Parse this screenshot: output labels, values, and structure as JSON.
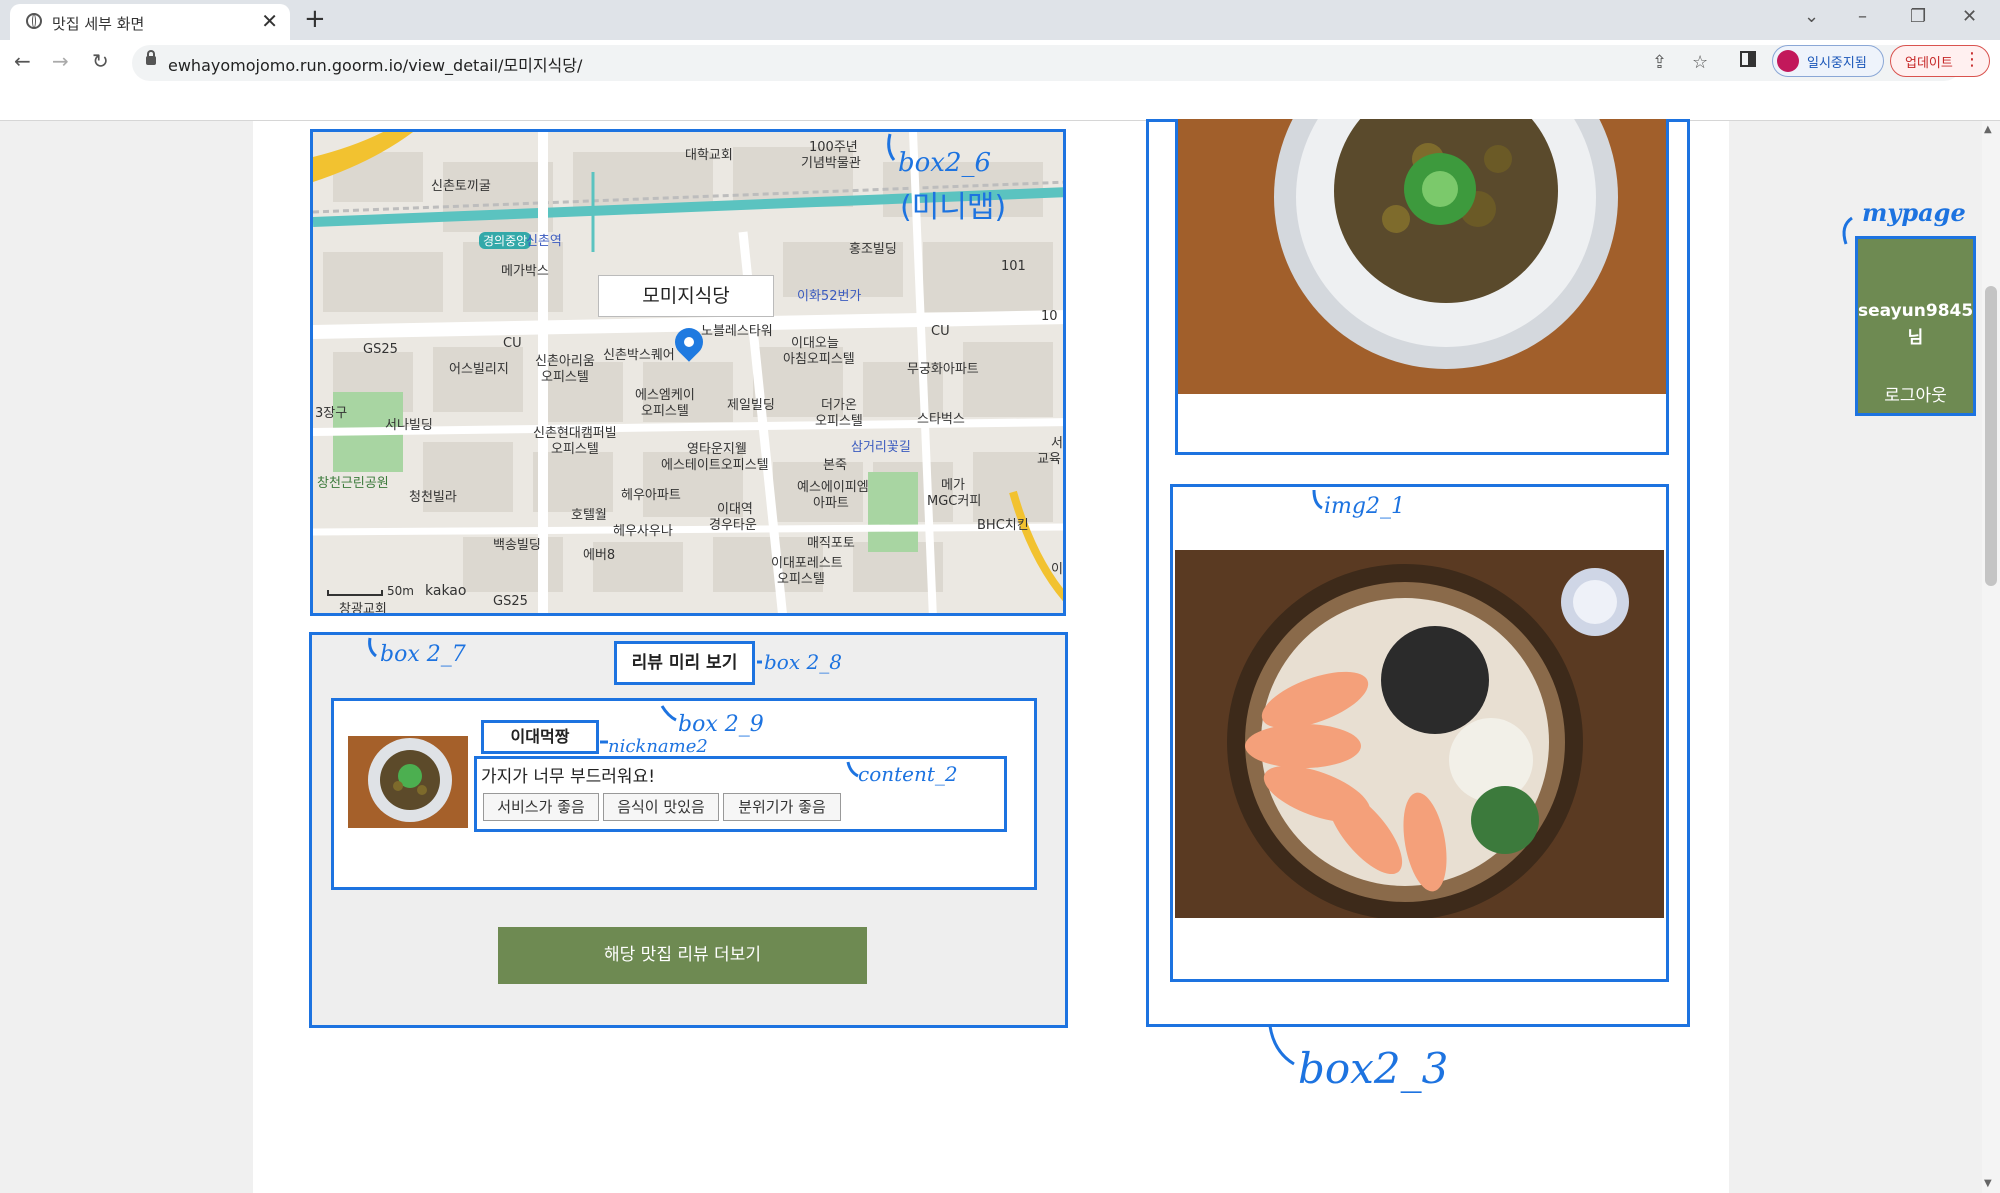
{
  "browser": {
    "tab_title": "맛집 세부 화면",
    "url": "ewhayomojomo.run.goorm.io/view_detail/모미지식당/",
    "profile_label": "일시중지됨",
    "update_label": "업데이트"
  },
  "map": {
    "restaurant_name": "모미지식당",
    "scale": "50m",
    "provider": "kakao",
    "labels": [
      "대학교회",
      "100주년",
      "기념박물관",
      "신촌토끼굴",
      "경의중앙",
      "신촌역",
      "홍조빌딩",
      "메가박스",
      "이화52번가",
      "101",
      "10",
      "노블레스타워",
      "신촌박스퀘어",
      "GS25",
      "CU",
      "어스빌리지",
      "신촌아리움",
      "오피스텔",
      "이대오늘",
      "아침오피스텔",
      "CU",
      "무궁화아파트",
      "에스엠케이",
      "오피스텔",
      "제일빌딩",
      "더가온",
      "오피스텔",
      "스타벅스",
      "3장구",
      "서나빌딩",
      "신촌현대캠퍼빌",
      "오피스텔",
      "영타운지웰",
      "에스테이트오피스텔",
      "본죽",
      "삼거리꽃길",
      "창천근린공원",
      "청천빌라",
      "호텔월",
      "헤우아파트",
      "이대역",
      "경우타운",
      "예스에이피엠",
      "아파트",
      "메가",
      "MGC커피",
      "BHC치킨",
      "헤우사우나",
      "백송빌딩",
      "매직포토",
      "에버8",
      "이대포레스트",
      "오피스텔",
      "창광교회",
      "GS25",
      "서",
      "교육",
      "이"
    ]
  },
  "review_preview": {
    "title": "리뷰 미리 보기",
    "nickname": "이대먹짱",
    "text": "가지가 너무 부드러워요!",
    "tags": [
      "서비스가 좋음",
      "음식이 맛있음",
      "분위기가 좋음"
    ],
    "more_button": "해당 맛집 리뷰 더보기"
  },
  "mypage": {
    "username": "seayun9845",
    "suffix": "님",
    "logout": "로그아웃"
  },
  "annotations": {
    "box2_6": "box2_6",
    "minimap": "(미니맵)",
    "box2_7": "box 2_7",
    "box2_8": "box 2_8",
    "box2_9": "box 2_9",
    "nickname2": "nickname2",
    "content_2": "content_2",
    "img2_1": "img2_1",
    "box2_3": "box2_3",
    "mypage": "mypage"
  },
  "colors": {
    "annotation_blue": "#1d73e0",
    "button_green": "#6e8a52"
  },
  "icons": {
    "tab": "globe-icon",
    "back": "arrow-left-icon",
    "forward": "arrow-right-icon",
    "reload": "reload-icon",
    "share": "share-icon",
    "bookmark": "star-icon",
    "side_panel": "side-panel-icon",
    "map_marker": "map-pin-icon"
  }
}
